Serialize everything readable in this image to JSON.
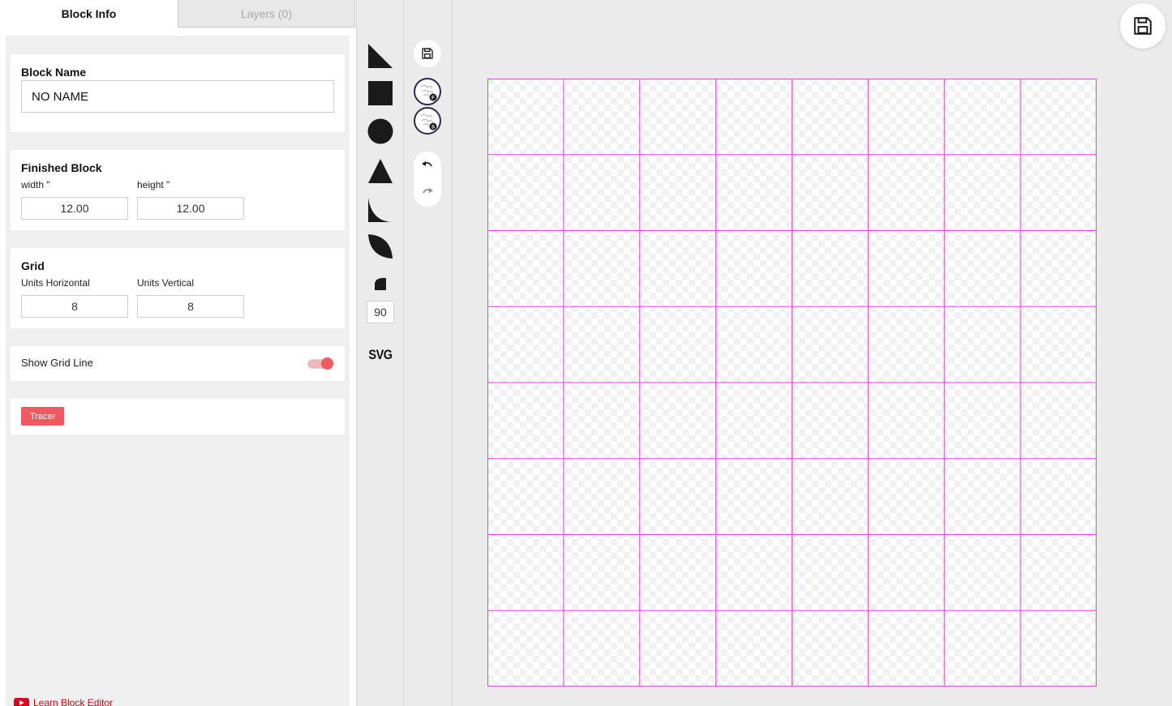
{
  "tabs": [
    {
      "label": "Block Info",
      "active": true
    },
    {
      "label": "Layers (0)",
      "active": false
    }
  ],
  "block_name": {
    "label": "Block Name",
    "value": "NO NAME"
  },
  "finished_block": {
    "title": "Finished Block",
    "width_label": "width \"",
    "width_value": "12.00",
    "height_label": "height \"",
    "height_value": "12.00"
  },
  "grid": {
    "title": "Grid",
    "horizontal_label": "Units Horizontal",
    "horizontal_value": "8",
    "vertical_label": "Units Vertical",
    "vertical_value": "8"
  },
  "show_grid_line": {
    "label": "Show Grid Line",
    "on": true
  },
  "tracer": {
    "label": "Tracer"
  },
  "learn_link": {
    "label": "Learn Block Editor"
  },
  "shape_tools": {
    "items": [
      "right-triangle",
      "square",
      "circle",
      "triangle",
      "concave-curve",
      "leaf",
      "quarter-shape"
    ],
    "angle_value": "90",
    "svg_label": "SVG"
  },
  "colors": {
    "accent": "#f0595f",
    "grid_line": "#e040e0",
    "link": "#e1001a"
  },
  "canvas": {
    "cols": 8,
    "rows": 8
  }
}
